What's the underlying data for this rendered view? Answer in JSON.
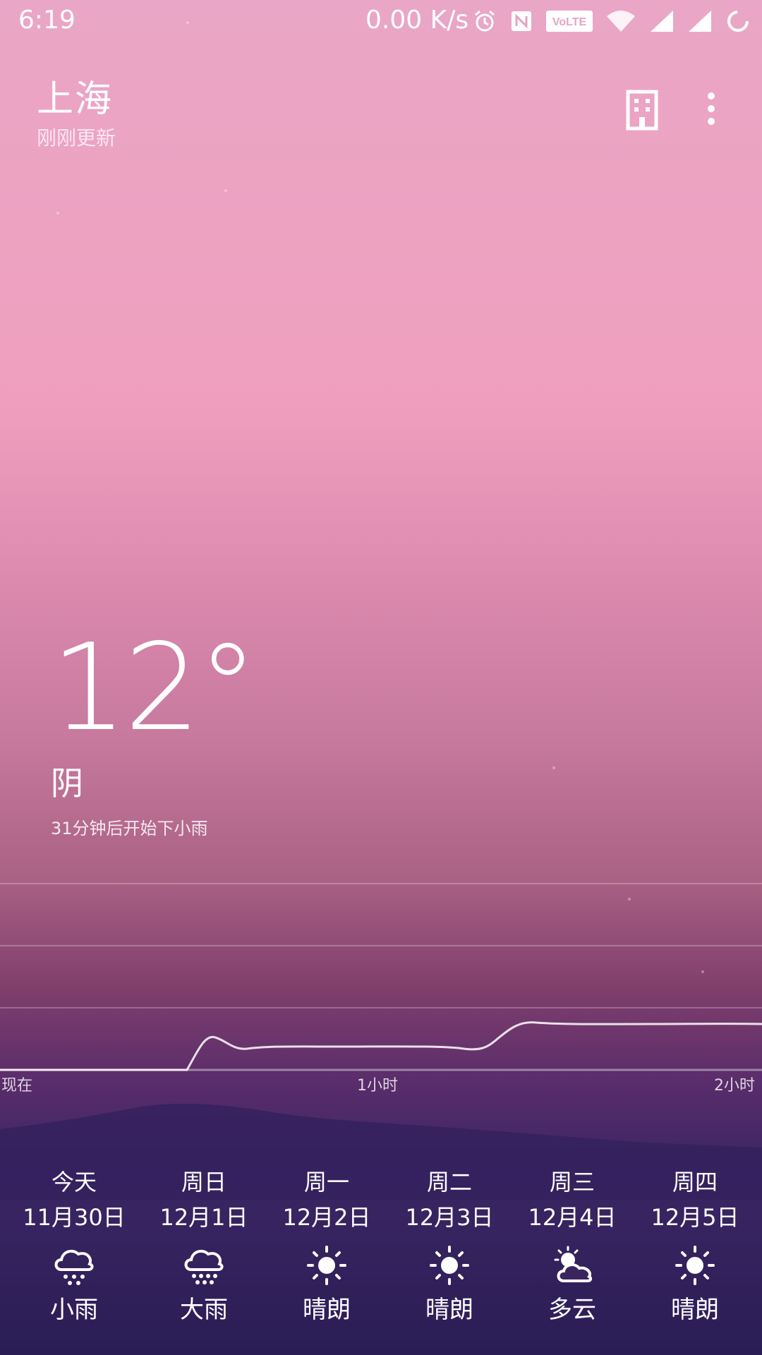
{
  "status_bar": {
    "time": "6:19",
    "net_speed": "0.00 K/s",
    "icons": [
      "alarm-icon",
      "nfc-icon",
      "volte-icon",
      "wifi-icon",
      "signal-icon",
      "signal-icon",
      "loading-icon"
    ],
    "volte_label": "VoLTE"
  },
  "header": {
    "city": "上海",
    "updated": "刚刚更新",
    "actions": [
      "building-icon",
      "more-vert-icon"
    ]
  },
  "current": {
    "temperature": "12°",
    "condition": "阴",
    "precip_hint": "31分钟后开始下小雨"
  },
  "rain_chart": {
    "x_labels": [
      "现在",
      "1小时",
      "2小时"
    ]
  },
  "forecast": [
    {
      "day": "今天",
      "date": "11月30日",
      "icon": "light-rain-icon",
      "weather": "小雨"
    },
    {
      "day": "周日",
      "date": "12月1日",
      "icon": "heavy-rain-icon",
      "weather": "大雨"
    },
    {
      "day": "周一",
      "date": "12月2日",
      "icon": "sun-icon",
      "weather": "晴朗"
    },
    {
      "day": "周二",
      "date": "12月3日",
      "icon": "sun-icon",
      "weather": "晴朗"
    },
    {
      "day": "周三",
      "date": "12月4日",
      "icon": "partly-cloudy-icon",
      "weather": "多云"
    },
    {
      "day": "周四",
      "date": "12月5日",
      "icon": "sun-icon",
      "weather": "晴朗"
    }
  ]
}
